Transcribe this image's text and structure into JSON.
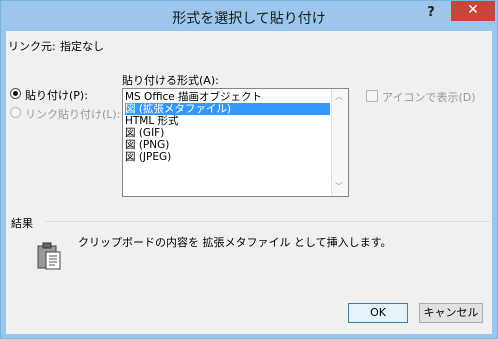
{
  "window": {
    "title": "形式を選択して貼り付け",
    "help": "?",
    "close": "✕"
  },
  "source": {
    "label": "リンク元:",
    "value": "指定なし"
  },
  "paste_options": {
    "paste_label": "貼り付け(P):",
    "link_label": "リンク貼り付け(L):"
  },
  "format": {
    "label": "貼り付ける形式(A):",
    "items": [
      "MS Office 描画オブジェクト",
      "図 (拡張メタファイル)",
      "HTML 形式",
      "図 (GIF)",
      "図 (PNG)",
      "図 (JPEG)"
    ],
    "selected_index": 1
  },
  "icon_option": {
    "label": "アイコンで表示(D)"
  },
  "result": {
    "heading": "結果",
    "description": "クリップボードの内容を 拡張メタファイル として挿入します。"
  },
  "buttons": {
    "ok": "OK",
    "cancel": "キャンセル"
  }
}
